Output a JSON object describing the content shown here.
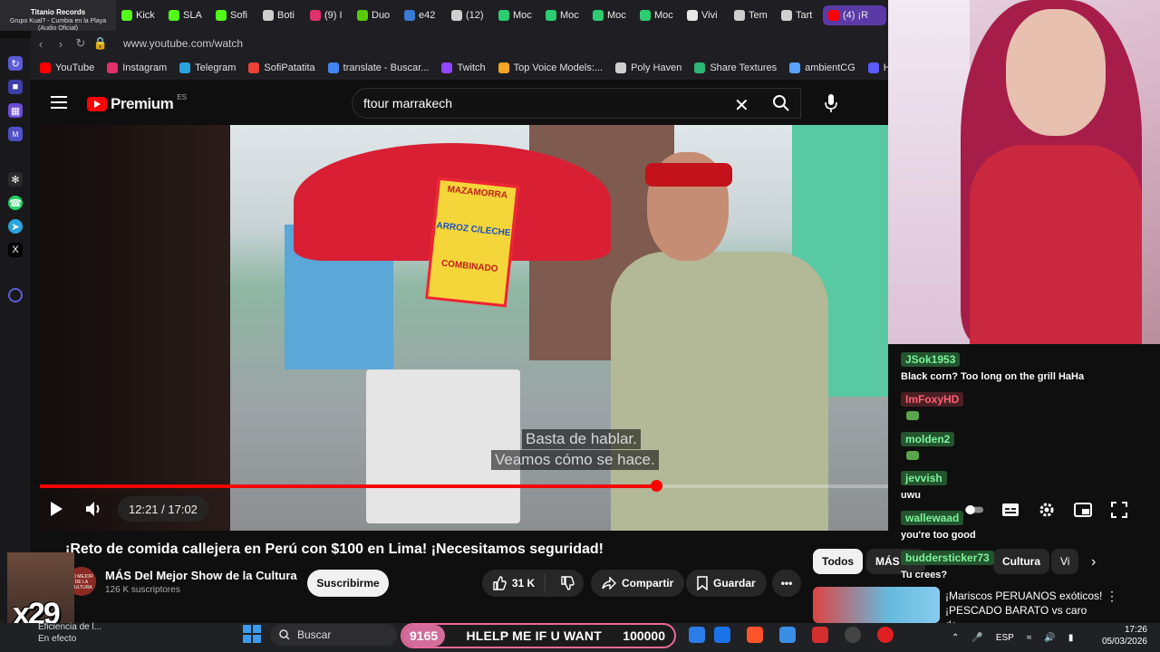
{
  "browser": {
    "media_tab": {
      "title": "Titanio Records",
      "subtitle": "Grupo Kual? - Cumbia en la Playa (Audio Oficial)"
    },
    "tabs": [
      {
        "label": "Kick",
        "color": "#53fc18"
      },
      {
        "label": "SLA",
        "color": "#53fc18"
      },
      {
        "label": "Sofi",
        "color": "#53fc18"
      },
      {
        "label": "Boti",
        "color": "#cfcfcf"
      },
      {
        "label": "(9) I",
        "color": "#e1306c"
      },
      {
        "label": "Duo",
        "color": "#58cc02"
      },
      {
        "label": "e42",
        "color": "#3a7bd5"
      },
      {
        "label": "(12)",
        "color": "#cfcfcf"
      },
      {
        "label": "Moc",
        "color": "#2ecc71"
      },
      {
        "label": "Moc",
        "color": "#2ecc71"
      },
      {
        "label": "Moc",
        "color": "#2ecc71"
      },
      {
        "label": "Moc",
        "color": "#2ecc71"
      },
      {
        "label": "Vivi",
        "color": "#e8e8e8"
      },
      {
        "label": "Tem",
        "color": "#cfcfcf"
      },
      {
        "label": "Tart",
        "color": "#cfcfcf"
      },
      {
        "label": "(4) ¡R",
        "color": "#ff0000",
        "active": true
      }
    ],
    "url": "www.youtube.com/watch",
    "bookmarks": [
      {
        "label": "YouTube",
        "color": "#ff0000"
      },
      {
        "label": "Instagram",
        "color": "#e1306c"
      },
      {
        "label": "Telegram",
        "color": "#2aa3df"
      },
      {
        "label": "SofiPatatita",
        "color": "#ea4335"
      },
      {
        "label": "translate - Buscar...",
        "color": "#4285f4"
      },
      {
        "label": "Twitch",
        "color": "#9146ff"
      },
      {
        "label": "Top Voice Models:...",
        "color": "#f5a623"
      },
      {
        "label": "Poly Haven",
        "color": "#cfcfcf"
      },
      {
        "label": "Share Textures",
        "color": "#2bb673"
      },
      {
        "label": "ambientCG",
        "color": "#5aa0ff"
      },
      {
        "label": "Ha",
        "color": "#5a5aff"
      }
    ]
  },
  "youtube": {
    "logo_text": "Premium",
    "region": "ES",
    "search_query": "ftour marrakech",
    "subtitle_line1": "Basta de hablar.",
    "subtitle_line2": "Veamos cómo se hace.",
    "time_display": "12:21 / 17:02",
    "progress_fraction": 0.7263,
    "video_title": "¡Reto de comida callejera en Perú con $100 en Lima! ¡Necesitamos seguridad!",
    "channel_name": "MÁS Del Mejor Show de la Cultura",
    "channel_avatar_text": "LO MEJOR DE LA CULTURA",
    "channel_subs": "126 K suscriptores",
    "subscribe_label": "Suscribirme",
    "like_count": "31 K",
    "share_label": "Compartir",
    "save_label": "Guardar",
    "sign_top": "MAZAMORRA",
    "sign_mid": "ARROZ C/LECHE",
    "sign_bottom": "COMBINADO",
    "chips": [
      "Todos",
      "MÁS De",
      "Cultura",
      "Vi"
    ],
    "recommended_title": "¡Mariscos PERUANOS exóticos! ¡PESCADO BARATO vs caro de..."
  },
  "chat": [
    {
      "user": "JSok1953",
      "text": "Black corn? Too long on the grill HaHa",
      "style": "green"
    },
    {
      "user": "ImFoxyHD",
      "text": "",
      "style": "red"
    },
    {
      "user": "molden2",
      "text": "",
      "style": "green"
    },
    {
      "user": "jevvish",
      "text": "uwu",
      "style": "green"
    },
    {
      "user": "wallewaad",
      "text": "you're too good",
      "style": "green"
    },
    {
      "user": "buddersticker73",
      "text": "Tu crees?",
      "style": "green"
    }
  ],
  "overlay": {
    "meme_text": "x29",
    "goal_left": "9165",
    "goal_text": "HLELP ME IF U WANT",
    "goal_right": "100000"
  },
  "taskbar": {
    "search_placeholder": "Buscar",
    "notification_line1": "Eficiencia de l...",
    "notification_line2": "En efecto",
    "language": "ESP",
    "time": "17:26",
    "date": "05/03/2026"
  },
  "colors": {
    "yt_red": "#ff0000",
    "chat_green": "#7cf39a",
    "chat_red": "#ff5d7a",
    "goal_pink": "#e96a9a"
  }
}
